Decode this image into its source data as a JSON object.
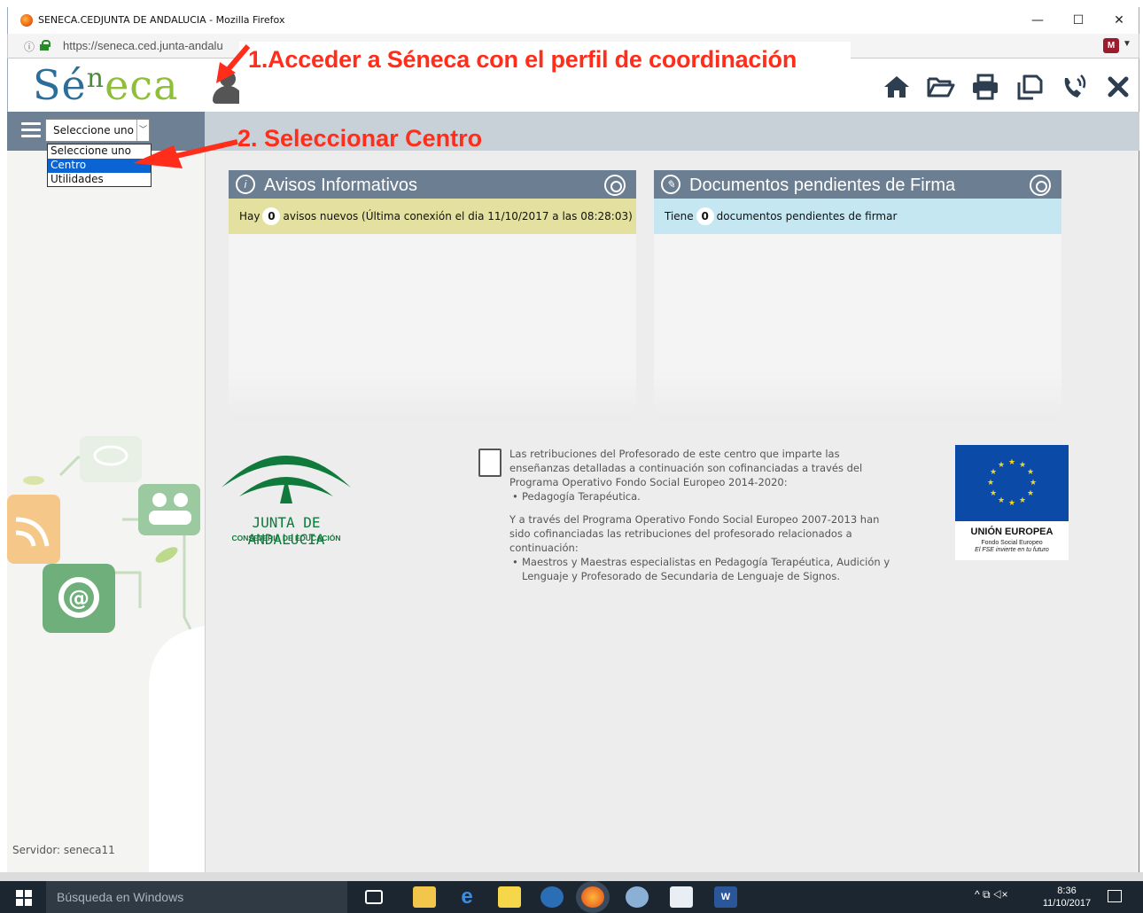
{
  "window": {
    "title": "SENECA.CEDJUNTA DE ANDALUCIA - Mozilla Firefox",
    "minimize": "—",
    "maximize": "☐",
    "close": "✕"
  },
  "urlbar": {
    "url": "https://seneca.ced.junta-andalu"
  },
  "app": {
    "logo_se": "Sé",
    "logo_n": "n",
    "logo_eca": "eca",
    "annotation_1": "1.Acceder a Séneca con el perfil de coordinación",
    "annotation_2": "2. Seleccionar Centro",
    "toolbar_icons": [
      "home-icon",
      "folder-open-icon",
      "print-icon",
      "copy-icon",
      "phone-icon",
      "close-icon"
    ]
  },
  "sidebar": {
    "select_value": "Seleccione uno",
    "options": [
      "Seleccione uno",
      "Centro",
      "Utilidades"
    ],
    "selected_option": "Centro",
    "server": "Servidor: seneca11"
  },
  "panels": {
    "avisos": {
      "title": "Avisos Informativos",
      "msg_prefix": "Hay",
      "count": "0",
      "msg_suffix": "avisos nuevos (Última conexión el dia 11/10/2017 a las 08:28:03)",
      "bg": "#e3e0a0"
    },
    "documentos": {
      "title": "Documentos pendientes de Firma",
      "msg_prefix": "Tiene",
      "count": "0",
      "msg_suffix": "documentos pendientes de firmar",
      "bg": "#c4e7f2"
    }
  },
  "footer": {
    "junta_name": "JUNTA DE ANDALUCIA",
    "junta_sub": "CONSEJERIA DE EDUCACIÓN",
    "info_p1": "Las retribuciones del Profesorado de este centro que imparte las enseñanzas detalladas a continuación son cofinanciadas a través del Programa Operativo Fondo Social Europeo 2014-2020:",
    "info_li1": "Pedagogía Terapéutica.",
    "info_p2": "Y a través del Programa Operativo Fondo Social Europeo 2007-2013 han sido cofinanciadas las retribuciones del profesorado relacionados a continuación:",
    "info_li2": "Maestros y Maestras especialistas en Pedagogía Terapéutica, Audición y Lenguaje y Profesorado de Secundaria de Lenguaje de Signos.",
    "eu_title": "UNIÓN EUROPEA",
    "eu_sub1": "Fondo Social Europeo",
    "eu_sub2": "El FSE invierte en tu futuro"
  },
  "taskbar": {
    "search_placeholder": "Búsqueda en Windows",
    "time": "8:36",
    "date": "11/10/2017",
    "tray": "^ ⧉ ◁×"
  },
  "colors": {
    "header_blue": "#6c7e91",
    "annotation_red": "#ff2d1a",
    "brand_blue": "#2d6e99"
  }
}
